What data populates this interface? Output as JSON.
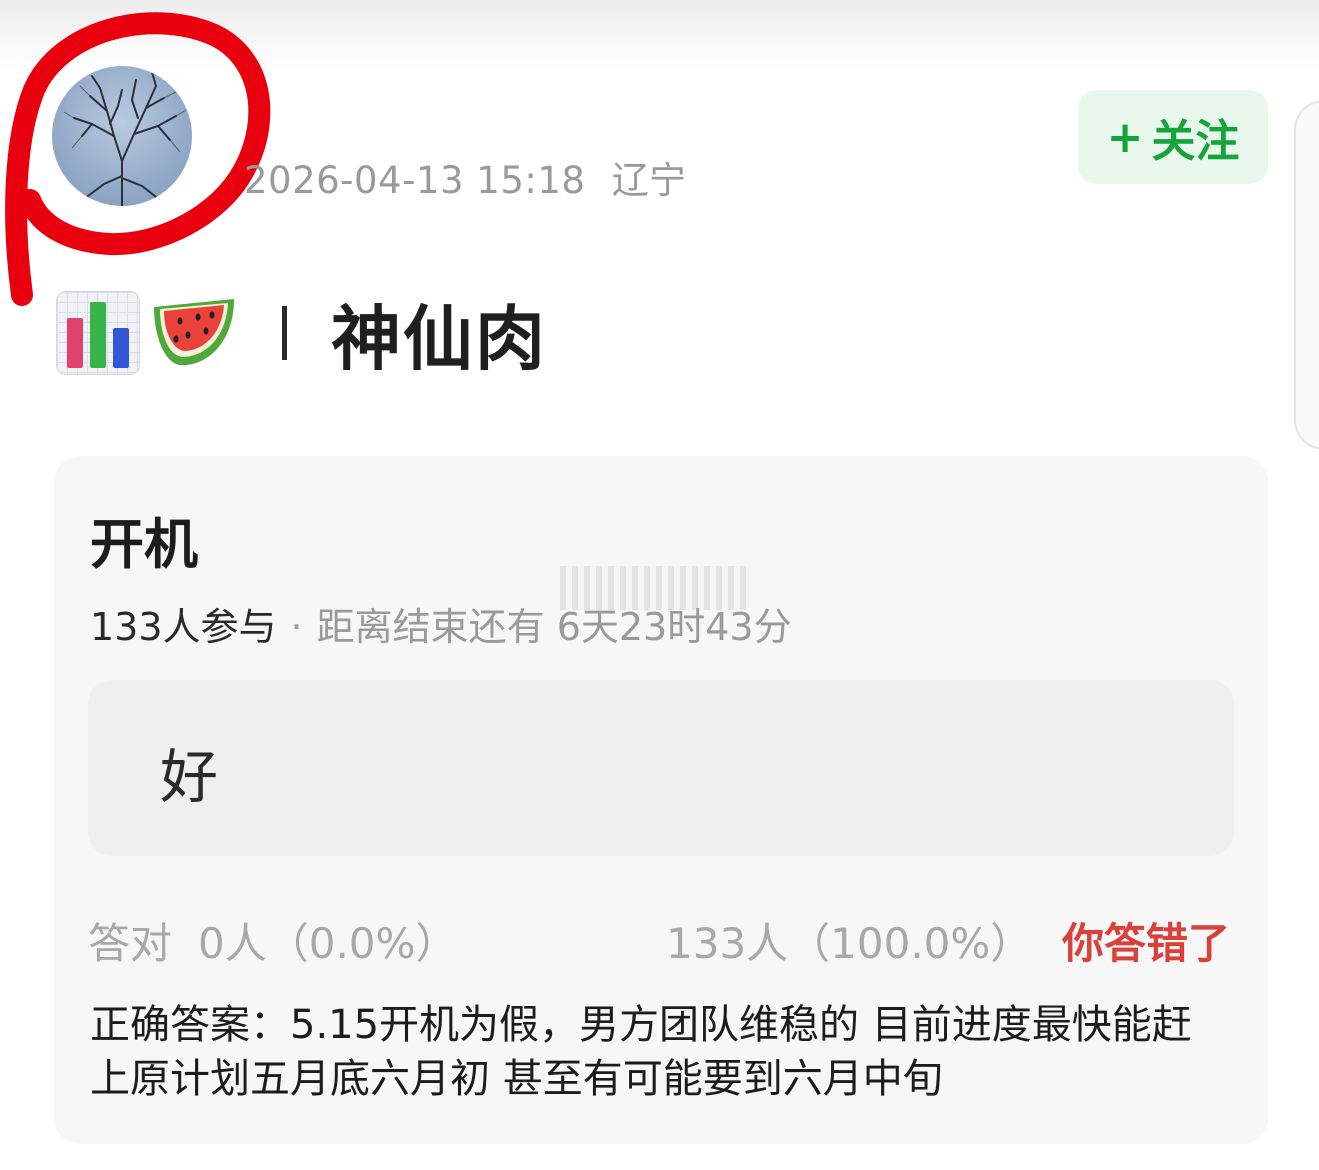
{
  "post": {
    "timestamp": "2026-04-13 15:18",
    "location": "辽宁",
    "follow_label": "关注",
    "follow_plus": "+",
    "title_separator": "|",
    "title": "神仙肉",
    "emoji_icons": [
      "bar-chart-icon",
      "watermelon-icon"
    ]
  },
  "quiz": {
    "title": "开机",
    "participants": "133人参与",
    "separator": "·",
    "remaining": "距离结束还有 6天23时43分",
    "option_text": "好",
    "correct_label": "答对",
    "correct_stat": "0人（0.0%）",
    "wrong_stat": "133人（100.0%）",
    "wrong_badge": "你答错了",
    "answer": "正确答案：5.15开机为假，男方团队维稳的 目前进度最快能赶上原计划五月底六月初 甚至有可能要到六月中旬"
  },
  "colors": {
    "follow_text": "#15a33a",
    "follow_bg": "#e9f8ec",
    "wrong_text": "#d9413b",
    "annotation_red": "#e8000f"
  }
}
